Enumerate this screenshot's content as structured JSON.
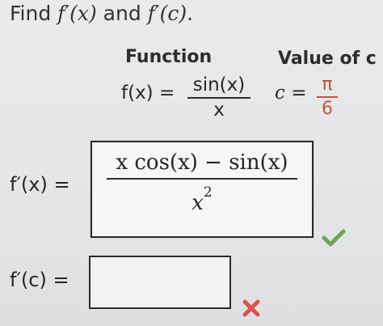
{
  "instruction": {
    "prefix": "Find ",
    "f_prime_x": "f′(x)",
    "conj": " and ",
    "f_prime_c": "f′(c)",
    "suffix": "."
  },
  "table": {
    "header_function": "Function",
    "header_value": "Value of c",
    "function_lhs": "f(x) =",
    "function_numerator": "sin(x)",
    "function_denominator": "x",
    "c_lhs": "c =",
    "c_numerator": "π",
    "c_denominator": "6"
  },
  "answer_1": {
    "label": "f′(x) =",
    "numerator": "x cos(x) − sin(x)",
    "denominator_base": "x",
    "denominator_exp": "2",
    "status": "correct"
  },
  "answer_2": {
    "label": "f′(c) =",
    "value": "",
    "status": "incorrect"
  },
  "colors": {
    "correct": "#6aa84f",
    "incorrect": "#d9534f",
    "pi_fraction": "#c2543a"
  }
}
